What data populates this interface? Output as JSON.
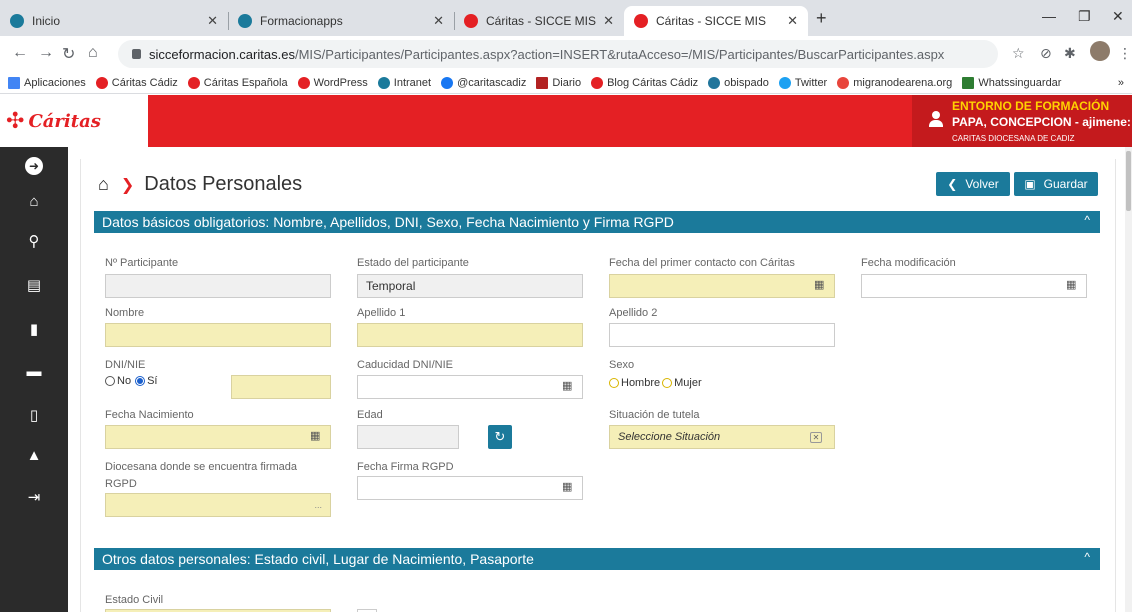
{
  "browser": {
    "tabs": [
      {
        "title": "Inicio",
        "fav_color": "#1b7a9b"
      },
      {
        "title": "Formacionapps",
        "fav_color": "#1b7a9b"
      },
      {
        "title": "Cáritas - SICCE MIS",
        "fav_color": "#e42024"
      },
      {
        "title": "Cáritas - SICCE MIS",
        "fav_color": "#e42024"
      }
    ],
    "url_host": "sicceformacion.caritas.es",
    "url_path": "/MIS/Participantes/Participantes.aspx?action=INSERT&rutaAcceso=/MIS/Participantes/BuscarParticipantes.aspx",
    "bookmarks": [
      {
        "label": "Aplicaciones",
        "color": "#4285f4"
      },
      {
        "label": "Cáritas Cádiz",
        "color": "#e42024"
      },
      {
        "label": "Cáritas Española",
        "color": "#e42024"
      },
      {
        "label": "WordPress",
        "color": "#e42024"
      },
      {
        "label": "Intranet",
        "color": "#1b7a9b"
      },
      {
        "label": "@caritascadiz",
        "color": "#1877f2"
      },
      {
        "label": "Diario",
        "color": "#b22222"
      },
      {
        "label": "Blog Cáritas Cádiz",
        "color": "#e42024"
      },
      {
        "label": "obispado",
        "color": "#21759b"
      },
      {
        "label": "Twitter",
        "color": "#1da1f2"
      },
      {
        "label": "migranodearena.org",
        "color": "#e8453c"
      },
      {
        "label": "Whatssinguardar",
        "color": "#2e7d32"
      }
    ],
    "more": "»"
  },
  "header": {
    "logo_text": "Cáritas",
    "env": "ENTORNO DE FORMACIÓN",
    "user": "PAPA, CONCEPCION - ajimene:",
    "org": "CARITAS DIOCESANA DE CADIZ"
  },
  "page": {
    "title": "Datos Personales",
    "back_label": "Volver",
    "save_label": "Guardar"
  },
  "section1": {
    "title": "Datos básicos obligatorios: Nombre, Apellidos, DNI, Sexo, Fecha Nacimiento y Firma RGPD",
    "labels": {
      "num_participante": "Nº Participante",
      "estado": "Estado del participante",
      "fecha_contacto": "Fecha del primer contacto con Cáritas",
      "fecha_mod": "Fecha modificación",
      "nombre": "Nombre",
      "apellido1": "Apellido 1",
      "apellido2": "Apellido 2",
      "dni": "DNI/NIE",
      "caducidad": "Caducidad DNI/NIE",
      "sexo": "Sexo",
      "fecha_nac": "Fecha Nacimiento",
      "edad": "Edad",
      "tutela": "Situación de tutela",
      "diocesana_1": "Diocesana donde se encuentra firmada",
      "diocesana_2": "RGPD",
      "fecha_firma": "Fecha Firma RGPD"
    },
    "values": {
      "estado": "Temporal",
      "tutela_placeholder": "Seleccione Situación",
      "dni_no": "No",
      "dni_si": "Sí",
      "sexo_hombre": "Hombre",
      "sexo_mujer": "Mujer",
      "diocesana_ellipsis": "..."
    }
  },
  "section2": {
    "title": "Otros datos personales: Estado civil, Lugar de Nacimiento, Pasaporte",
    "labels": {
      "estado_civil": "Estado Civil"
    }
  }
}
